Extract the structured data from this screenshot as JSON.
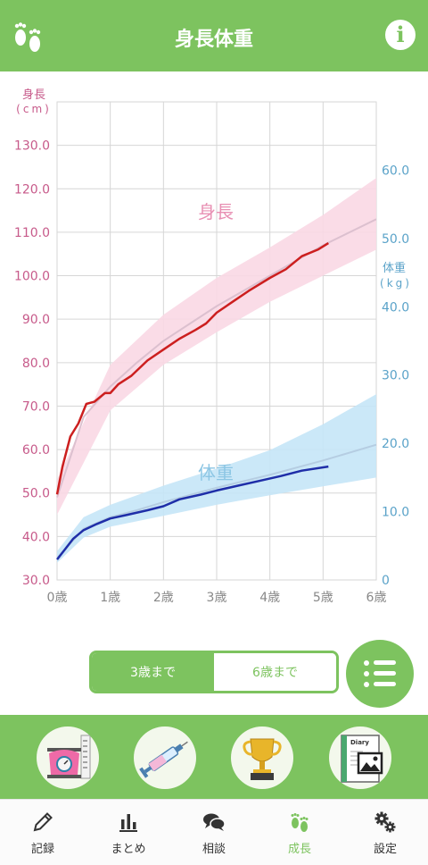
{
  "header": {
    "title": "身長体重",
    "logo_icon": "footprints-icon",
    "info_icon": "info-icon",
    "info_glyph": "i"
  },
  "chart_data": [
    {
      "type": "line",
      "title": "身長",
      "ylabel": "身長",
      "yunit": "(cm)",
      "ylim": [
        30,
        140
      ],
      "y_ticks": [
        "30.0",
        "40.0",
        "50.0",
        "60.0",
        "70.0",
        "80.0",
        "90.0",
        "100.0",
        "110.0",
        "120.0",
        "130.0"
      ],
      "xlim": [
        0,
        6
      ],
      "x_ticks": [
        "0歳",
        "1歳",
        "2歳",
        "3歳",
        "4歳",
        "5歳",
        "6歳"
      ],
      "series": [
        {
          "name": "身長",
          "color": "#cc1f1f",
          "points": [
            [
              0,
              49.7
            ],
            [
              0.1,
              56
            ],
            [
              0.25,
              63
            ],
            [
              0.4,
              66
            ],
            [
              0.55,
              70.5
            ],
            [
              0.7,
              71
            ],
            [
              0.9,
              73
            ],
            [
              1.0,
              73
            ],
            [
              1.15,
              75
            ],
            [
              1.4,
              77
            ],
            [
              1.7,
              80.5
            ],
            [
              2.0,
              83
            ],
            [
              2.3,
              85.5
            ],
            [
              2.6,
              87.5
            ],
            [
              2.8,
              89
            ],
            [
              3.0,
              91.5
            ],
            [
              3.3,
              94
            ],
            [
              3.6,
              96.5
            ],
            [
              4.0,
              99.5
            ],
            [
              4.3,
              101.5
            ],
            [
              4.6,
              104.5
            ],
            [
              4.9,
              106
            ],
            [
              5.1,
              107.5
            ]
          ]
        }
      ],
      "reference_mean": [
        [
          0,
          49
        ],
        [
          0.5,
          67.5
        ],
        [
          1,
          74.5
        ],
        [
          1.5,
          80
        ],
        [
          2,
          85
        ],
        [
          2.5,
          89
        ],
        [
          3,
          93
        ],
        [
          3.5,
          96.5
        ],
        [
          4,
          100
        ],
        [
          4.5,
          103.5
        ],
        [
          5,
          107
        ],
        [
          5.5,
          110
        ],
        [
          6,
          113
        ]
      ],
      "reference_band": {
        "low": [
          [
            0,
            45
          ],
          [
            1,
            69
          ],
          [
            2,
            79.5
          ],
          [
            3,
            87
          ],
          [
            4,
            94
          ],
          [
            5,
            100
          ],
          [
            6,
            106
          ]
        ],
        "high": [
          [
            0,
            53
          ],
          [
            1,
            79.5
          ],
          [
            2,
            91
          ],
          [
            3,
            99.5
          ],
          [
            4,
            106.5
          ],
          [
            5,
            114
          ],
          [
            6,
            122.5
          ]
        ]
      },
      "band_color": "#f9d8e4",
      "mean_color": "#dcc0cf",
      "label_color": "#c75a8a",
      "grid": true
    },
    {
      "type": "line",
      "title": "体重",
      "ylabel": "体重",
      "yunit": "(kg)",
      "ylim": [
        0,
        70
      ],
      "y_ticks": [
        "0",
        "10.0",
        "20.0",
        "30.0",
        "40.0",
        "50.0",
        "60.0"
      ],
      "xlim": [
        0,
        6
      ],
      "x_ticks": [
        "0歳",
        "1歳",
        "2歳",
        "3歳",
        "4歳",
        "5歳",
        "6歳"
      ],
      "series": [
        {
          "name": "体重",
          "color": "#1f2ea8",
          "points": [
            [
              0,
              3.0
            ],
            [
              0.15,
              4.5
            ],
            [
              0.3,
              6.0
            ],
            [
              0.5,
              7.3
            ],
            [
              0.75,
              8.2
            ],
            [
              1.0,
              9.0
            ],
            [
              1.3,
              9.5
            ],
            [
              1.7,
              10.2
            ],
            [
              2.0,
              10.8
            ],
            [
              2.3,
              11.8
            ],
            [
              2.7,
              12.5
            ],
            [
              3.0,
              13.1
            ],
            [
              3.4,
              13.8
            ],
            [
              3.8,
              14.5
            ],
            [
              4.2,
              15.2
            ],
            [
              4.6,
              16.0
            ],
            [
              5.1,
              16.6
            ]
          ]
        }
      ],
      "reference_mean": [
        [
          0,
          3.2
        ],
        [
          0.5,
          7.5
        ],
        [
          1,
          9.2
        ],
        [
          1.5,
          10.2
        ],
        [
          2,
          11.4
        ],
        [
          3,
          13.5
        ],
        [
          4,
          15.4
        ],
        [
          5,
          17.5
        ],
        [
          6,
          19.8
        ]
      ],
      "reference_band": {
        "low": [
          [
            0,
            2.5
          ],
          [
            0.5,
            6.2
          ],
          [
            1,
            7.8
          ],
          [
            2,
            9.4
          ],
          [
            3,
            11.0
          ],
          [
            4,
            12.4
          ],
          [
            5,
            13.7
          ],
          [
            6,
            15.0
          ]
        ],
        "high": [
          [
            0,
            4.2
          ],
          [
            0.5,
            9.2
          ],
          [
            1,
            11.0
          ],
          [
            2,
            13.8
          ],
          [
            3,
            16.3
          ],
          [
            4,
            19.0
          ],
          [
            5,
            22.8
          ],
          [
            6,
            27.2
          ]
        ]
      },
      "band_color": "#c5e6f7",
      "mean_color": "#b5cde2",
      "label_color": "#5ba3c9",
      "grid": true
    }
  ],
  "range_toggle": {
    "selected": "3歳まで",
    "options": [
      "3歳まで",
      "6歳まで"
    ]
  },
  "list_button": {
    "icon": "list-icon"
  },
  "features": [
    {
      "name": "scale-icon"
    },
    {
      "name": "syringe-icon"
    },
    {
      "name": "trophy-icon"
    },
    {
      "name": "diary-icon",
      "label": "Diary"
    }
  ],
  "bottom_nav": [
    {
      "label": "記録",
      "icon": "pencil-icon",
      "active": false
    },
    {
      "label": "まとめ",
      "icon": "bar-chart-icon",
      "active": false
    },
    {
      "label": "相談",
      "icon": "speech-bubbles-icon",
      "active": false
    },
    {
      "label": "成長",
      "icon": "footprints-icon",
      "active": true
    },
    {
      "label": "設定",
      "icon": "gears-icon",
      "active": false
    }
  ]
}
